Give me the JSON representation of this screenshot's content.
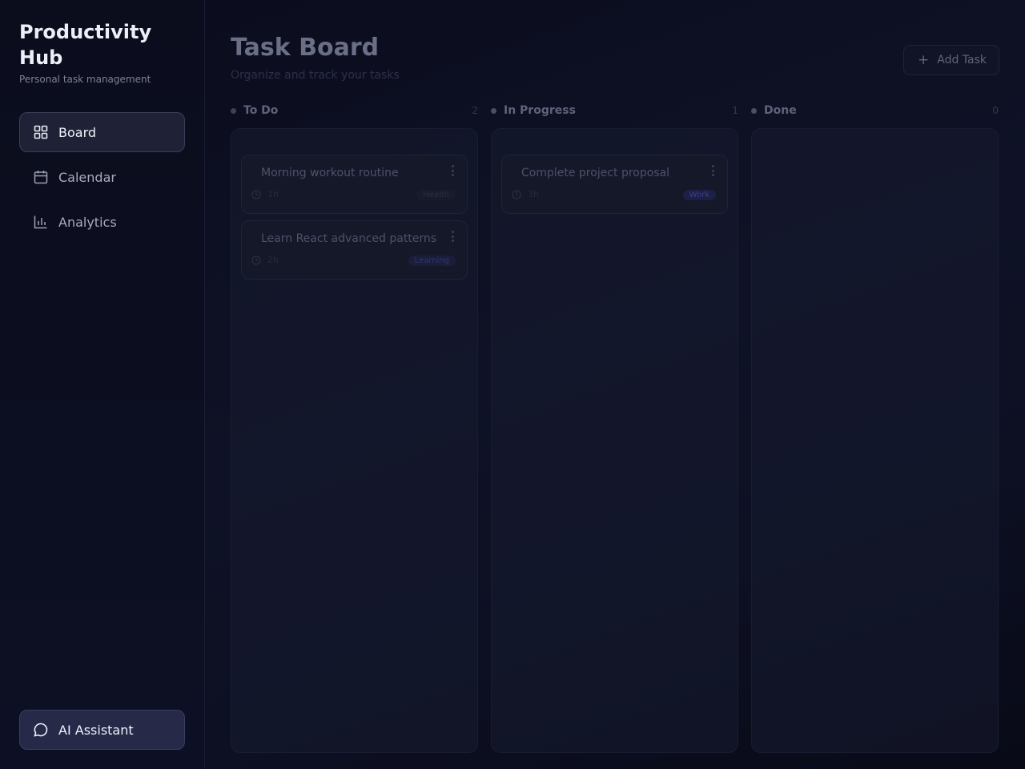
{
  "sidebar": {
    "title": "Productivity Hub",
    "subtitle": "Personal task management",
    "nav": [
      {
        "label": "Board",
        "icon": "grid-icon",
        "active": true
      },
      {
        "label": "Calendar",
        "icon": "calendar-icon",
        "active": false
      },
      {
        "label": "Analytics",
        "icon": "bar-chart-icon",
        "active": false
      }
    ],
    "assistant_label": "AI Assistant"
  },
  "header": {
    "title": "Task Board",
    "subtitle": "Organize and track your tasks",
    "add_label": "Add Task"
  },
  "columns": [
    {
      "name": "To Do",
      "count": "2",
      "dot_color": "#3c4058",
      "cards": [
        {
          "title": "Morning workout routine",
          "time": "1h",
          "tag": "Health",
          "tag_color": "#2a3040",
          "tag_bg": "#171b2a"
        },
        {
          "title": "Learn React advanced patterns",
          "time": "2h",
          "tag": "Learning",
          "tag_color": "#2f3770",
          "tag_bg": "#1a1e3a"
        }
      ]
    },
    {
      "name": "In Progress",
      "count": "1",
      "dot_color": "#4a4e66",
      "cards": [
        {
          "title": "Complete project proposal",
          "time": "3h",
          "tag": "Work",
          "tag_color": "#3a3f8a",
          "tag_bg": "#1d2044"
        }
      ]
    },
    {
      "name": "Done",
      "count": "0",
      "dot_color": "#4a4e66",
      "cards": []
    }
  ],
  "colors": {
    "accent": "#262a48",
    "background": "#0b0d1c"
  }
}
